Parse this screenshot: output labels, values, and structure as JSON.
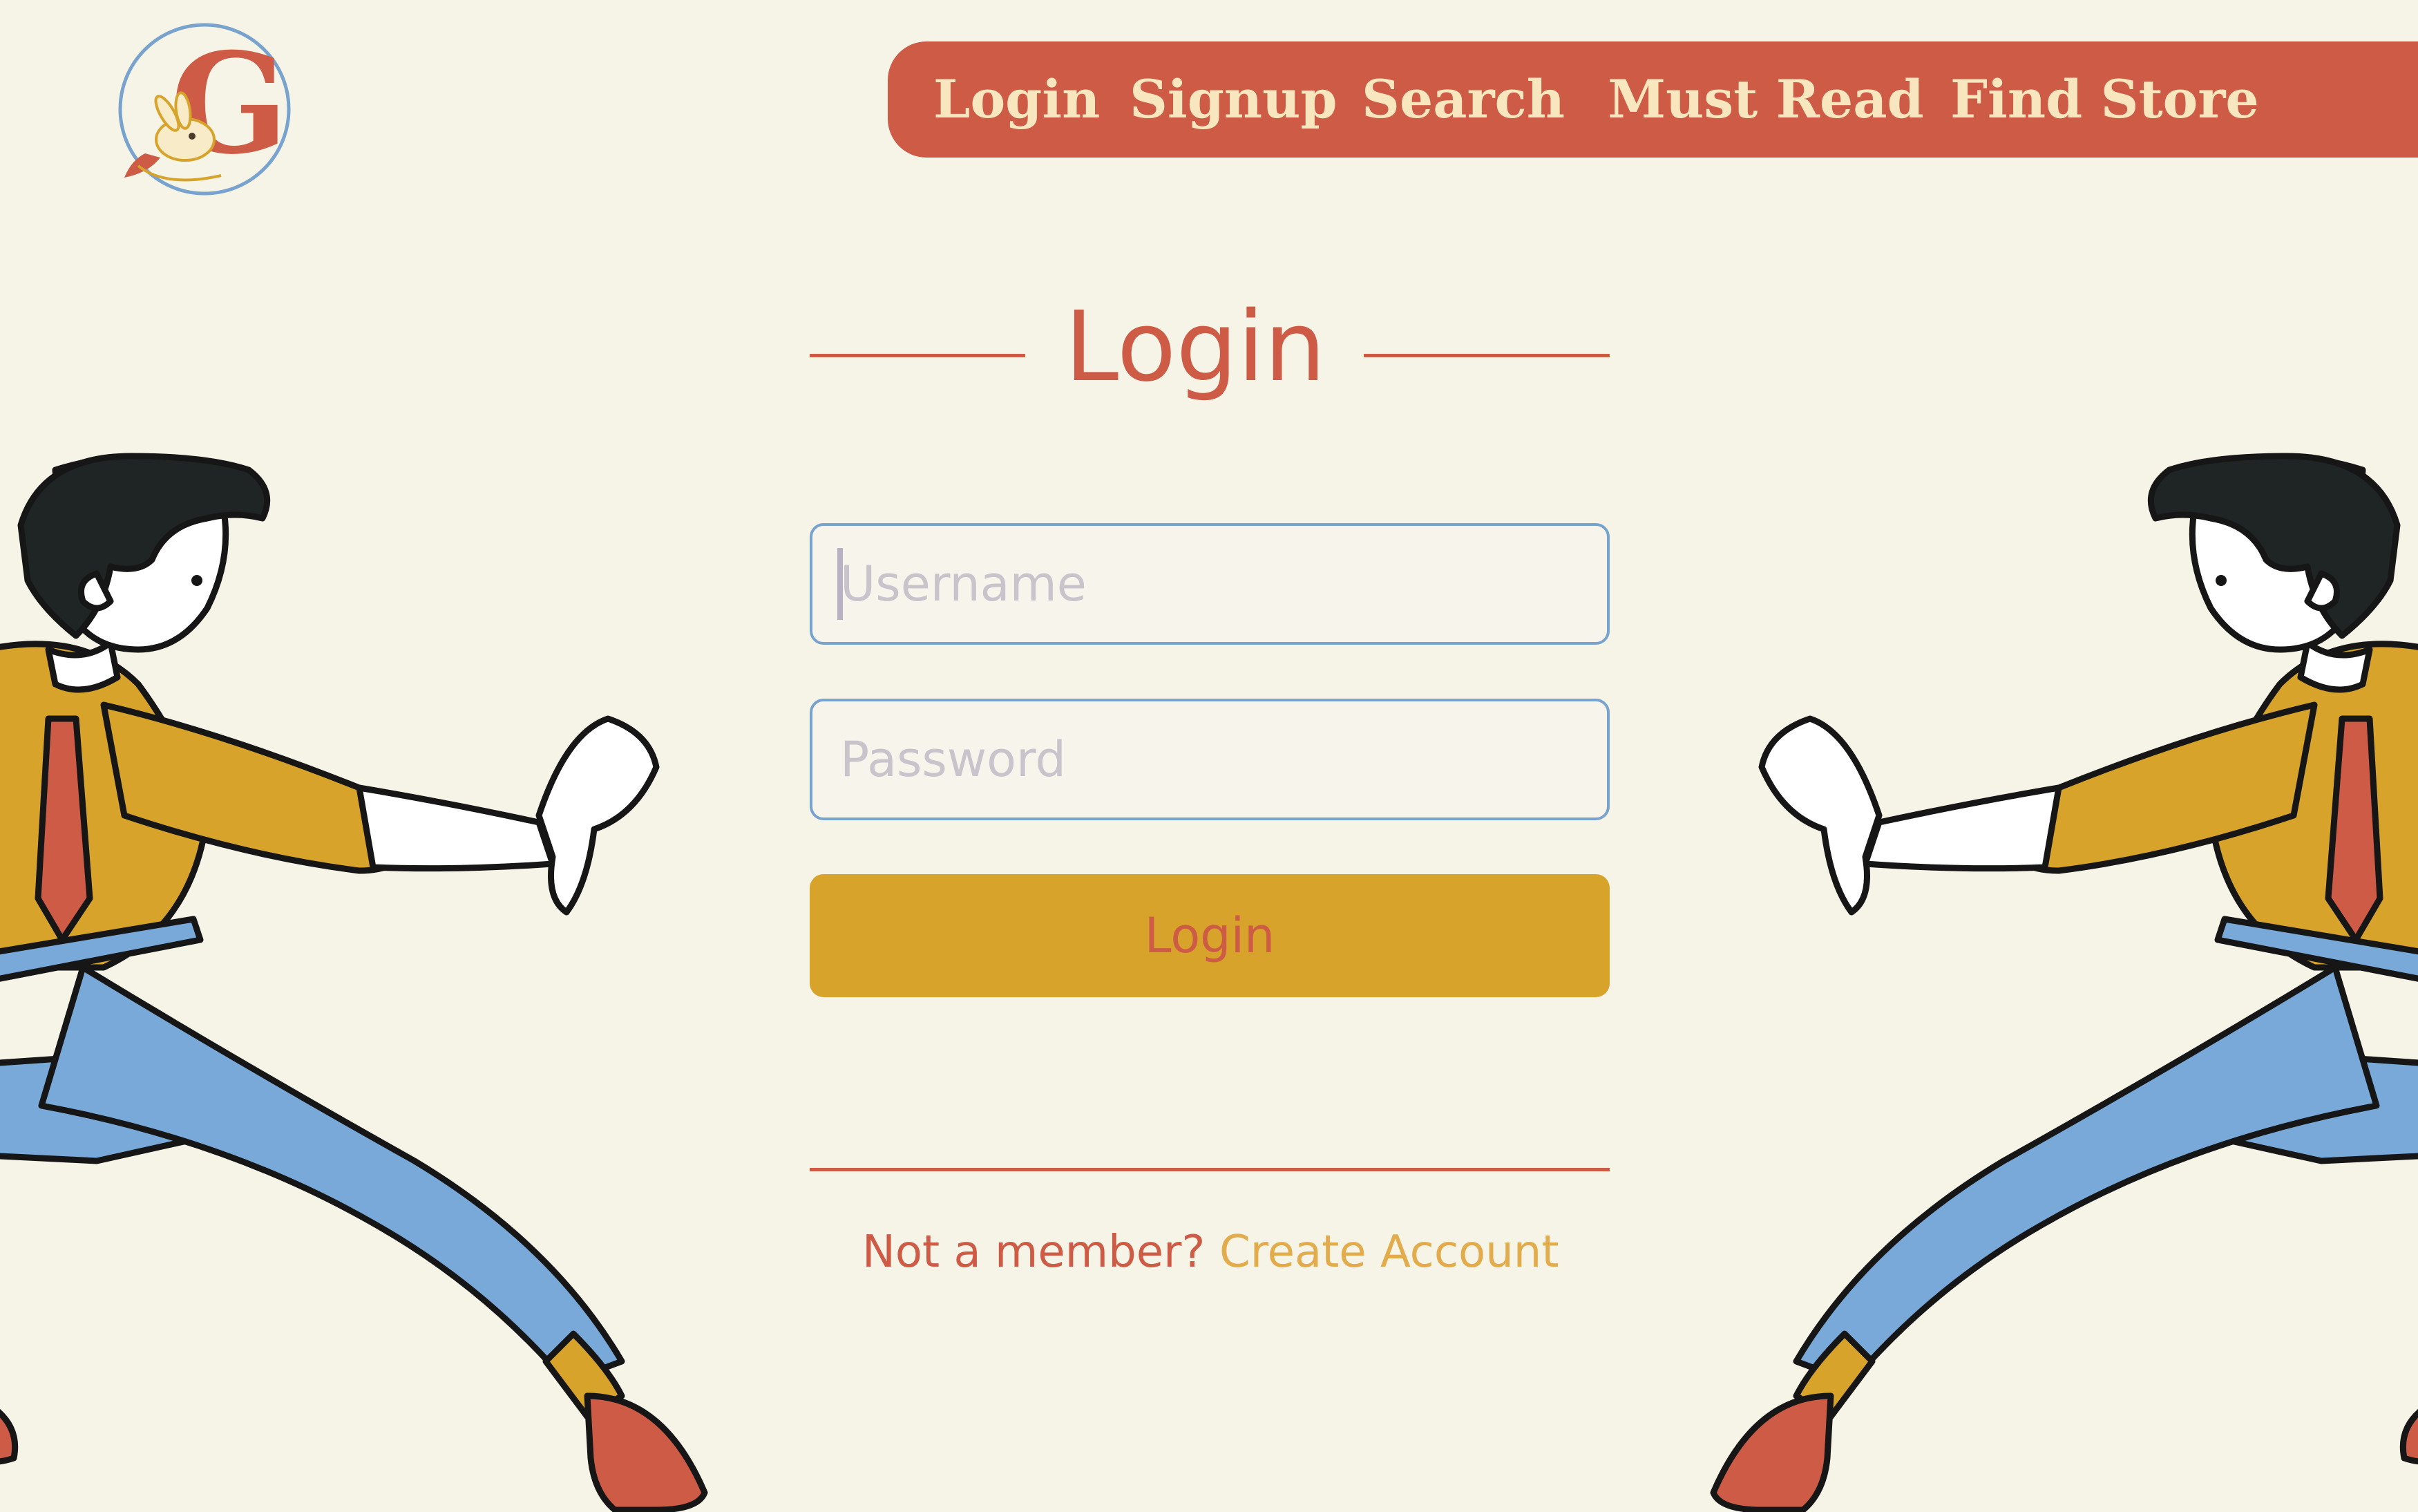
{
  "app": {
    "logo_letter": "G",
    "logo_icon": "rabbit-g-logo"
  },
  "nav": {
    "items": [
      {
        "label": "Login"
      },
      {
        "label": "Signup"
      },
      {
        "label": "Search"
      },
      {
        "label": "Must Read"
      },
      {
        "label": "Find Store"
      }
    ]
  },
  "login": {
    "title": "Login",
    "username_placeholder": "Username",
    "username_value": "",
    "password_placeholder": "Password",
    "password_value": "",
    "submit_label": "Login",
    "not_member_text": "Not a member?",
    "create_account_label": "Create Account"
  },
  "illustrations": {
    "left_icon": "kung-fu-man-illustration",
    "right_icon": "kung-fu-man-illustration"
  },
  "colors": {
    "background": "#F6F3E7",
    "nav_bar": "#CE5B45",
    "nav_text": "#F7E6BE",
    "accent_red": "#CE5B45",
    "accent_gold": "#D7A32B",
    "input_border": "#78A3CE",
    "link": "#E2AC4C"
  }
}
